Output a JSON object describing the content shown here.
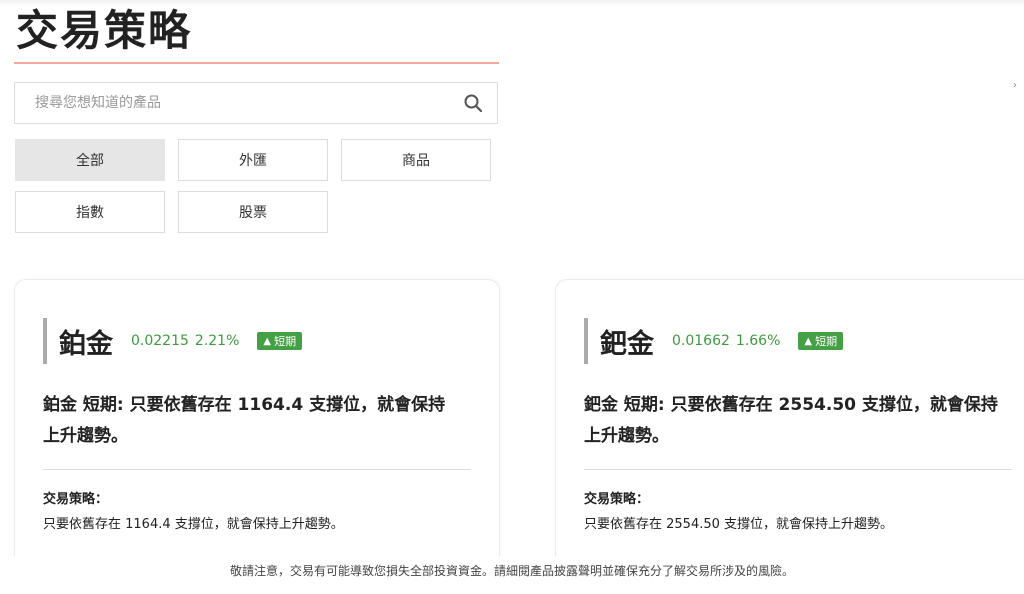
{
  "page": {
    "title": "交易策略"
  },
  "search": {
    "placeholder": "搜尋您想知道的產品"
  },
  "filters": [
    {
      "label": "全部",
      "active": true
    },
    {
      "label": "外匯",
      "active": false
    },
    {
      "label": "商品",
      "active": false
    },
    {
      "label": "指數",
      "active": false
    },
    {
      "label": "股票",
      "active": false
    }
  ],
  "cards": [
    {
      "name": "鉑金",
      "change": "0.02215",
      "percent": "2.21%",
      "badge": "短期",
      "headline_line1": "鉑金 短期: 只要依舊存在 1164.4 支撐位，就會保持",
      "headline_line2": "上升趨勢。",
      "strategy_label": "交易策略：",
      "strategy_text": "只要依舊存在 1164.4 支撐位，就會保持上升趨勢。"
    },
    {
      "name": "鈀金",
      "change": "0.01662",
      "percent": "1.66%",
      "badge": "短期",
      "headline_line1": "鈀金 短期: 只要依舊存在 2554.50 支撐位，就會保持",
      "headline_line2": "上升趨勢。",
      "strategy_label": "交易策略：",
      "strategy_text": "只要依舊存在 2554.50 支撐位，就會保持上升趨勢。"
    }
  ],
  "footer": {
    "disclaimer": "敬請注意，交易有可能導致您損失全部投資資金。請細閱產品披露聲明並確保充分了解交易所涉及的風險。"
  },
  "colors": {
    "positive": "#3f9a3f",
    "badge_bg": "#45a045",
    "title_underline": "#f0a99b"
  },
  "icons": {
    "search": "search-icon",
    "badge_arrow": "triangle-up-icon"
  }
}
